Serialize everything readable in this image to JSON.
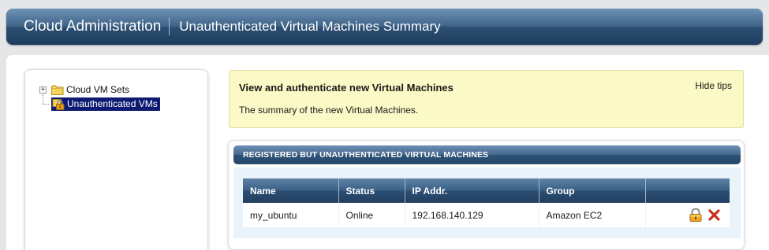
{
  "header": {
    "app_title": "Cloud Administration",
    "page_title": "Unauthenticated Virtual Machines Summary"
  },
  "tree": {
    "items": [
      {
        "label": "Cloud VM Sets",
        "icon": "folder-icon",
        "toggle": "+",
        "selected": false
      },
      {
        "label": "Unauthenticated VMs",
        "icon": "lock-icon",
        "selected": true
      }
    ]
  },
  "tips": {
    "title": "View and authenticate new Virtual Machines",
    "hide_label": "Hide tips",
    "text": "The summary of the new Virtual Machines."
  },
  "vm_section": {
    "title": "REGISTERED BUT UNAUTHENTICATED VIRTUAL MACHINES",
    "columns": [
      "Name",
      "Status",
      "IP Addr.",
      "Group",
      ""
    ],
    "rows": [
      {
        "name": "my_ubuntu",
        "status": "Online",
        "ip": "192.168.140.129",
        "group": "Amazon EC2",
        "actions": [
          "authenticate-lock-icon",
          "delete-x-icon"
        ]
      }
    ]
  },
  "colors": {
    "header_blue": "#2b4e72",
    "tips_bg": "#fbf9c6",
    "selection": "#0d1a72",
    "delete_red": "#c8321e",
    "lock_orange": "#e8a020"
  }
}
